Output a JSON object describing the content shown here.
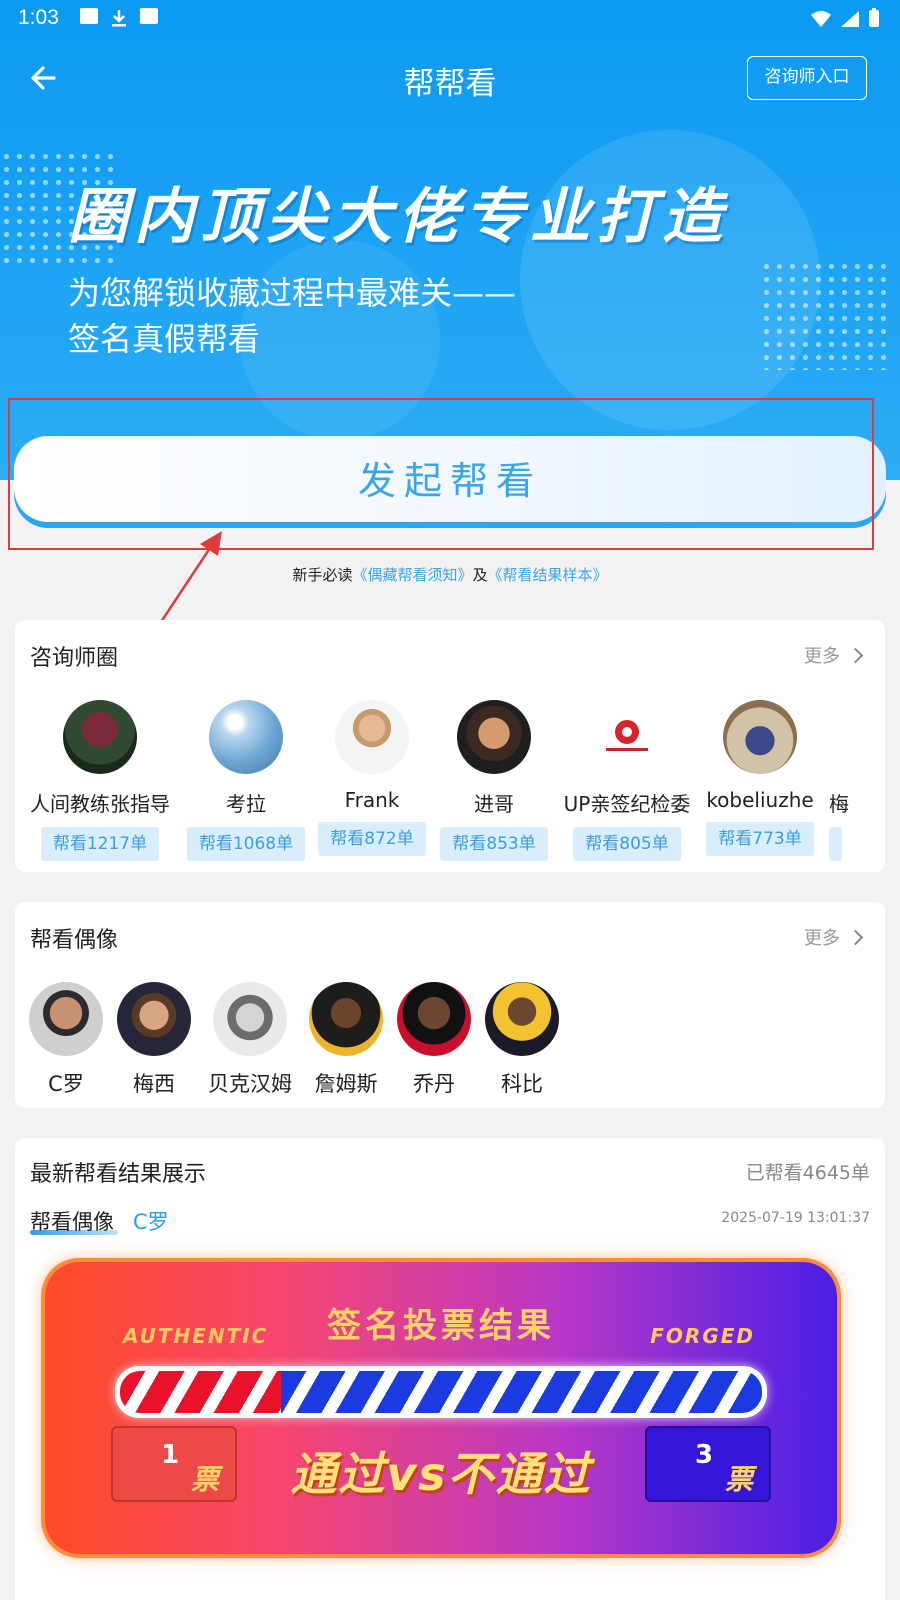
{
  "status_bar": {
    "time": "1:03"
  },
  "nav": {
    "title": "帮帮看",
    "consult_entry": "咨询师入口"
  },
  "hero": {
    "title": "圈内顶尖大佬专业打造",
    "subtitle_line1": "为您解锁收藏过程中最难关——",
    "subtitle_line2": "签名真假帮看"
  },
  "start_button": {
    "label": "发起帮看"
  },
  "notice": {
    "prefix": "新手必读",
    "link1": "《偶藏帮看须知》",
    "and": "及",
    "link2": "《帮看结果样本》"
  },
  "advisors": {
    "title": "咨询师圈",
    "more": "更多",
    "items": [
      {
        "name": "人间教练张指导",
        "badge": "帮看1217单"
      },
      {
        "name": "考拉",
        "badge": "帮看1068单"
      },
      {
        "name": "Frank",
        "badge": "帮看872单"
      },
      {
        "name": "进哥",
        "badge": "帮看853单"
      },
      {
        "name": "UP亲签纪检委",
        "badge": "帮看805单"
      },
      {
        "name": "kobeliuzhe",
        "badge": "帮看773单"
      },
      {
        "name": "梅"
      }
    ]
  },
  "idols": {
    "title": "帮看偶像",
    "more": "更多",
    "items": [
      {
        "name": "C罗"
      },
      {
        "name": "梅西"
      },
      {
        "name": "贝克汉姆"
      },
      {
        "name": "詹姆斯"
      },
      {
        "name": "乔丹"
      },
      {
        "name": "科比"
      }
    ]
  },
  "results": {
    "title": "最新帮看结果展示",
    "count": "已帮看4645单",
    "tag_label": "帮看偶像",
    "tag_value": "C罗",
    "time": "2025-07-19 13:01:37",
    "vote_title": "签名投票结果",
    "authentic": "AUTHENTIC",
    "forged": "FORGED",
    "pass_votes": "1",
    "fail_votes": "3",
    "unit": "票",
    "vs_text": "通过vs不通过",
    "pass_fraction": 0.25
  }
}
